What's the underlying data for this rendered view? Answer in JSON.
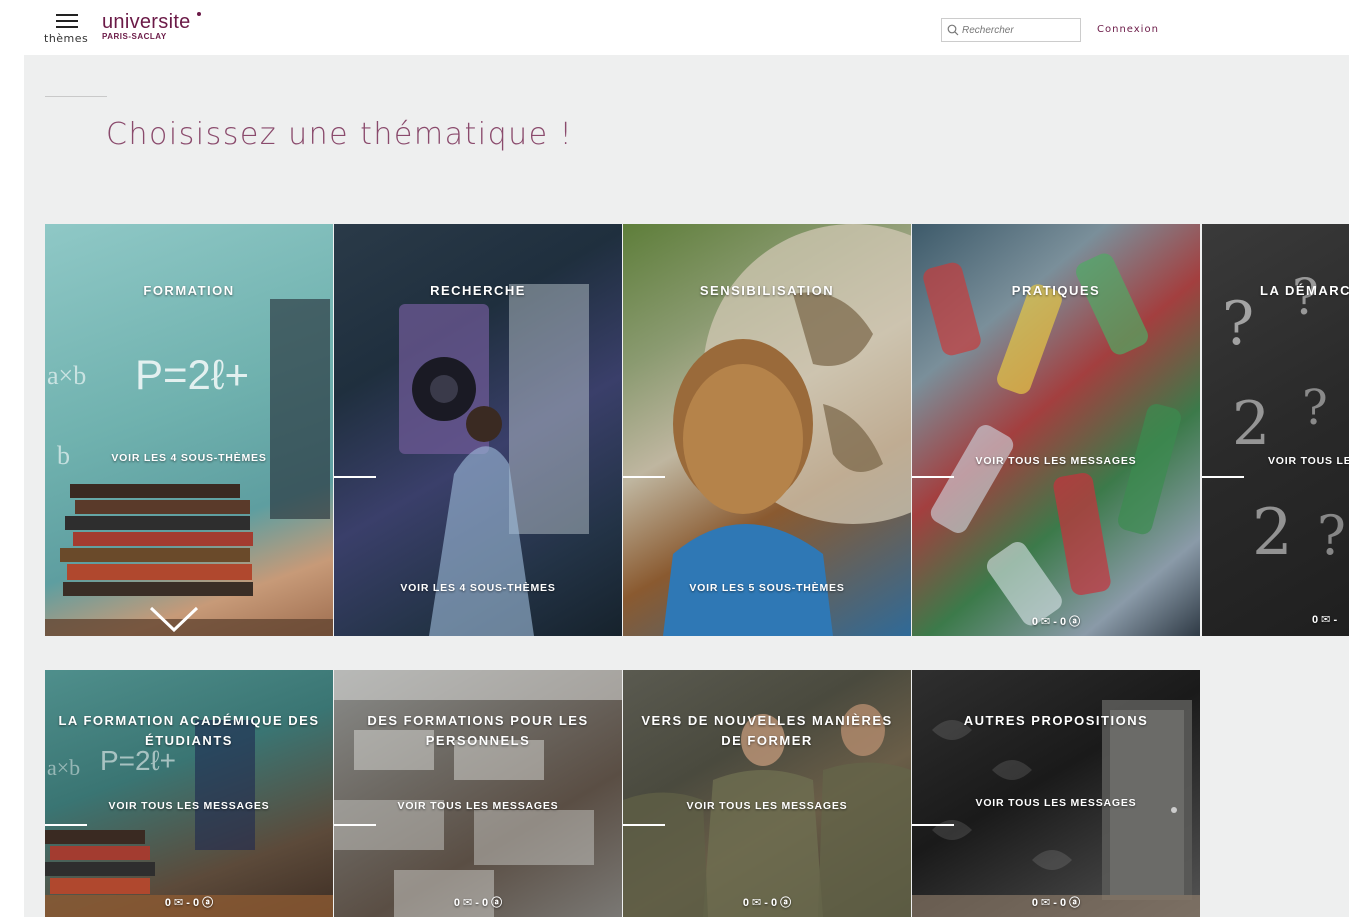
{
  "header": {
    "menu_label": "thèmes",
    "logo_word": "universite",
    "logo_sub": "PARIS-SACLAY",
    "search_placeholder": "Rechercher",
    "login_label": "Connexion"
  },
  "main": {
    "title": "Choisissez une thématique !"
  },
  "themes": [
    {
      "title": "FORMATION",
      "link": "VOIR LES 4 SOUS-THÈMES"
    },
    {
      "title": "RECHERCHE",
      "link": "VOIR LES 4 SOUS-THÈMES"
    },
    {
      "title": "SENSIBILISATION",
      "link": "VOIR LES 5 SOUS-THÈMES"
    },
    {
      "title": "PRATIQUES",
      "link": "VOIR TOUS LES MESSAGES",
      "counts": "0 ✉ - 0 ⓐ"
    },
    {
      "title": "LA DÉMARCHE",
      "link": "VOIR TOUS LES MESSAGES",
      "counts": "0 ✉ -"
    }
  ],
  "subthemes": [
    {
      "title": "LA FORMATION ACADÉMIQUE DES ÉTUDIANTS",
      "link": "VOIR TOUS LES MESSAGES",
      "counts": "0 ✉ - 0 ⓐ"
    },
    {
      "title": "DES FORMATIONS POUR LES PERSONNELS",
      "link": "VOIR TOUS LES MESSAGES",
      "counts": "0 ✉ - 0 ⓐ"
    },
    {
      "title": "VERS DE NOUVELLES MANIÈRES DE FORMER",
      "link": "VOIR TOUS LES MESSAGES",
      "counts": "0 ✉ - 0 ⓐ"
    },
    {
      "title": "AUTRES PROPOSITIONS",
      "link": "VOIR TOUS LES MESSAGES",
      "counts": "0 ✉ - 0 ⓐ"
    }
  ],
  "icons": {
    "menu": "hamburger-icon",
    "search": "search-icon",
    "expand": "chevron-down-icon"
  },
  "colors": {
    "brand": "#6b1a47",
    "title": "#8a4a6c",
    "panel_bg": "#eeefef"
  }
}
